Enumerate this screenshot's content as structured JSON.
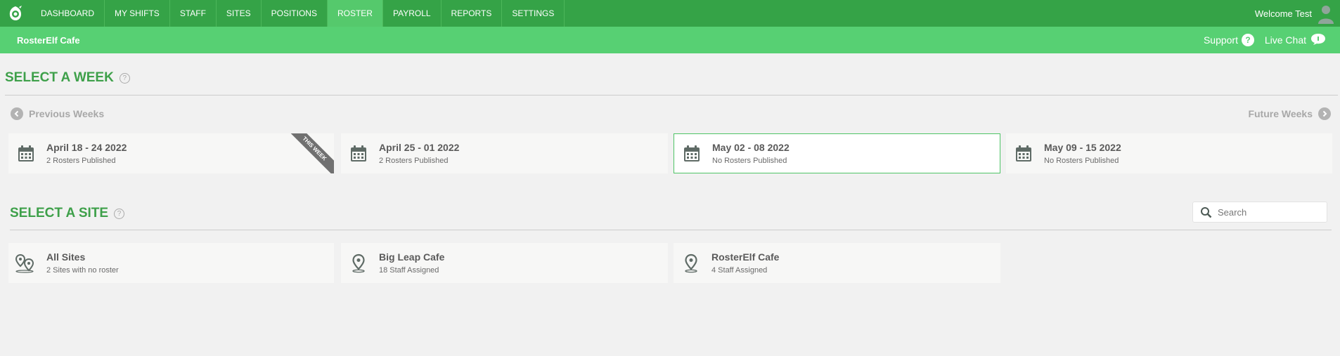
{
  "nav": {
    "items": [
      {
        "label": "DASHBOARD",
        "active": false
      },
      {
        "label": "MY SHIFTS",
        "active": false
      },
      {
        "label": "STAFF",
        "active": false
      },
      {
        "label": "SITES",
        "active": false
      },
      {
        "label": "POSITIONS",
        "active": false
      },
      {
        "label": "ROSTER",
        "active": true
      },
      {
        "label": "PAYROLL",
        "active": false
      },
      {
        "label": "REPORTS",
        "active": false
      },
      {
        "label": "SETTINGS",
        "active": false
      }
    ],
    "welcome": "Welcome Test"
  },
  "subbar": {
    "company": "RosterElf Cafe",
    "support": "Support",
    "support_icon_text": "?",
    "live_chat": "Live Chat"
  },
  "week_section": {
    "title": "SELECT A WEEK",
    "help_icon_text": "?",
    "previous": "Previous Weeks",
    "future": "Future Weeks",
    "this_week_ribbon": "THIS WEEK",
    "weeks": [
      {
        "title": "April 18 - 24 2022",
        "sub": "2 Rosters Published"
      },
      {
        "title": "April 25 - 01 2022",
        "sub": "2 Rosters Published"
      },
      {
        "title": "May 02 - 08 2022",
        "sub": "No Rosters Published"
      },
      {
        "title": "May 09 - 15 2022",
        "sub": "No Rosters Published"
      }
    ]
  },
  "site_section": {
    "title": "SELECT A SITE",
    "help_icon_text": "?",
    "search_placeholder": "Search",
    "sites": [
      {
        "title": "All Sites",
        "sub": "2 Sites with no roster"
      },
      {
        "title": "Big Leap Cafe",
        "sub": "18 Staff Assigned"
      },
      {
        "title": "RosterElf Cafe",
        "sub": "4 Staff Assigned"
      }
    ]
  },
  "colors": {
    "nav_green": "#35a347",
    "subbar_green": "#57d073",
    "heading_green": "#3ea04a"
  }
}
